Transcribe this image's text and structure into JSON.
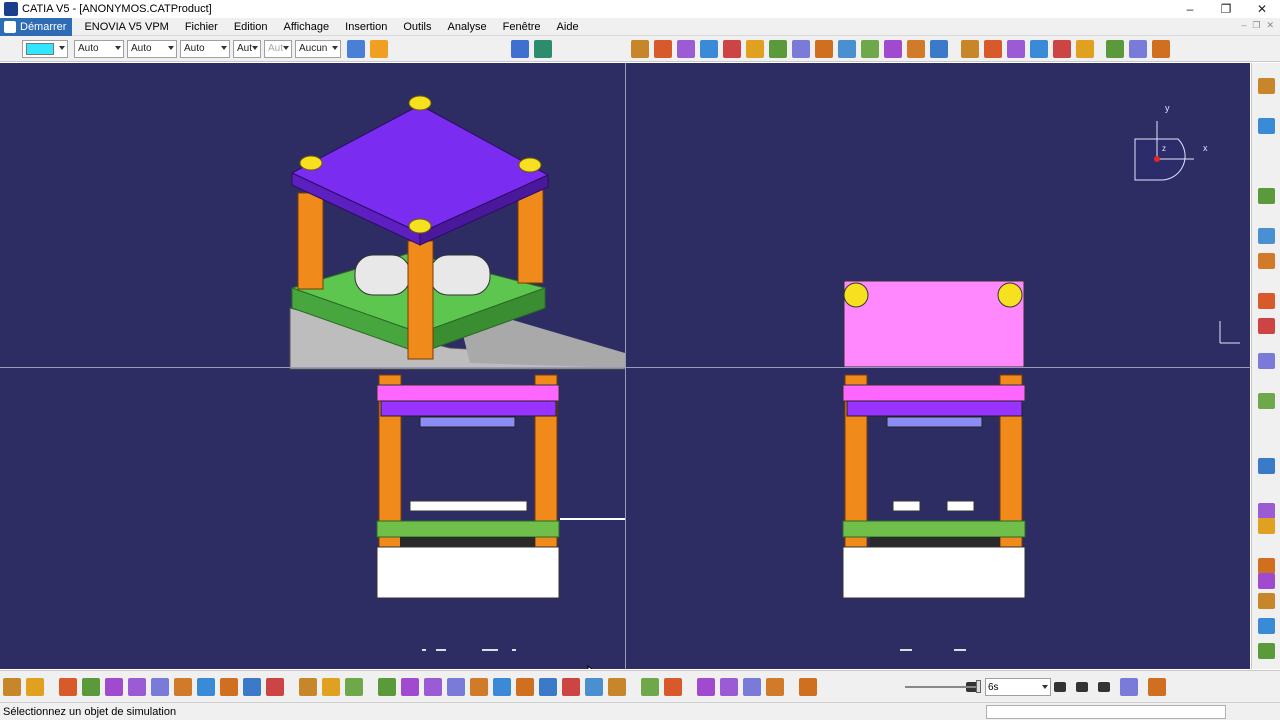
{
  "window": {
    "title": "CATIA V5 - [ANONYMOS.CATProduct]",
    "controls": [
      "–",
      "❐",
      "✕"
    ]
  },
  "menu": {
    "items": [
      "Démarrer",
      "ENOVIA V5 VPM",
      "Fichier",
      "Edition",
      "Affichage",
      "Insertion",
      "Outils",
      "Analyse",
      "Fenêtre",
      "Aide"
    ],
    "doc_controls": [
      "–",
      "❐",
      "✕"
    ]
  },
  "properties_toolbar": {
    "color_value": "#33e6ff",
    "selects": [
      "Auto",
      "Auto",
      "Auto",
      "Aut",
      "Aut",
      "Aucun"
    ]
  },
  "viewport": {
    "background": "#2d2d63",
    "compass": {
      "x": "x",
      "y": "y",
      "z": "z"
    }
  },
  "animation": {
    "speed_value": "6s"
  },
  "status": {
    "message": "Sélectionnez un objet de simulation"
  }
}
